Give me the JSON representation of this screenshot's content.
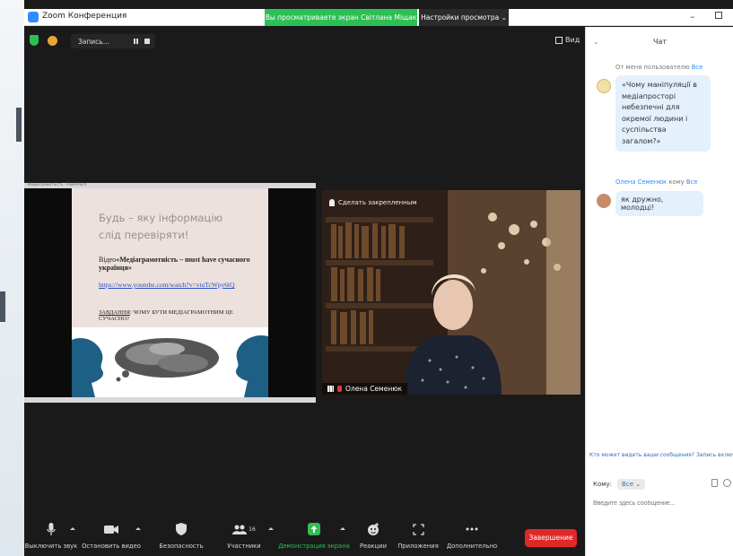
{
  "window": {
    "app_title": "Zoom Конференция",
    "share_banner": "Вы просматриваете экран Світлана Міщак",
    "view_options": "Настройки просмотра ⌄",
    "min_glyph": "–"
  },
  "meeting_top": {
    "recording_label": "Запись...",
    "view_label": "Вид"
  },
  "slide": {
    "window_title": "Медиаграмотність - PowerPoint",
    "heading_line1": "Будь – яку інформацію",
    "heading_line2": "слід перевіряти!",
    "video_prefix": "Відео",
    "video_title": "«Медіаграмотність – must have сучасного українця»",
    "link": "https://www.youtube.com/watch?v=vtuTcWpy6tQ",
    "task_label": "ЗАВДАННЯ",
    "task_text": ": ЧОМУ БУТИ МЕДІАГРАМОТНИМ ЦЕ СУЧАСНО?"
  },
  "camera": {
    "top_label": "Сделать закрепленным",
    "participant_name": "Олена Семенюк"
  },
  "toolbar": {
    "mute": "Выключить звук",
    "stop_video": "Остановить видео",
    "security": "Безопасность",
    "participants": "Участники",
    "participants_count": "16",
    "share_screen": "Демонстрация экрана",
    "reactions": "Реакции",
    "apps": "Приложения",
    "more": "Дополнительно",
    "end": "Завершение"
  },
  "chat": {
    "title": "Чат",
    "msg1_sender": "От меня пользователю",
    "msg1_to": "Все",
    "msg1_text": "«Чому маніпуляції в медіапросторі небезпечні для окремої людини і суспільства загалом?»",
    "msg2_sender": "Олена Семенюк",
    "msg2_mid": "кому",
    "msg2_to": "Все",
    "msg2_text": "як дружно, молодці!",
    "notice": "Кто может видеть ваши сообщения? Запись включена",
    "to_label": "Кому:",
    "to_value": "Все ⌄",
    "input_placeholder": "Введите здесь сообщение..."
  },
  "colors": {
    "accent_green": "#2dbf54",
    "end_red": "#e02828",
    "chat_blue": "#2d8cff"
  }
}
